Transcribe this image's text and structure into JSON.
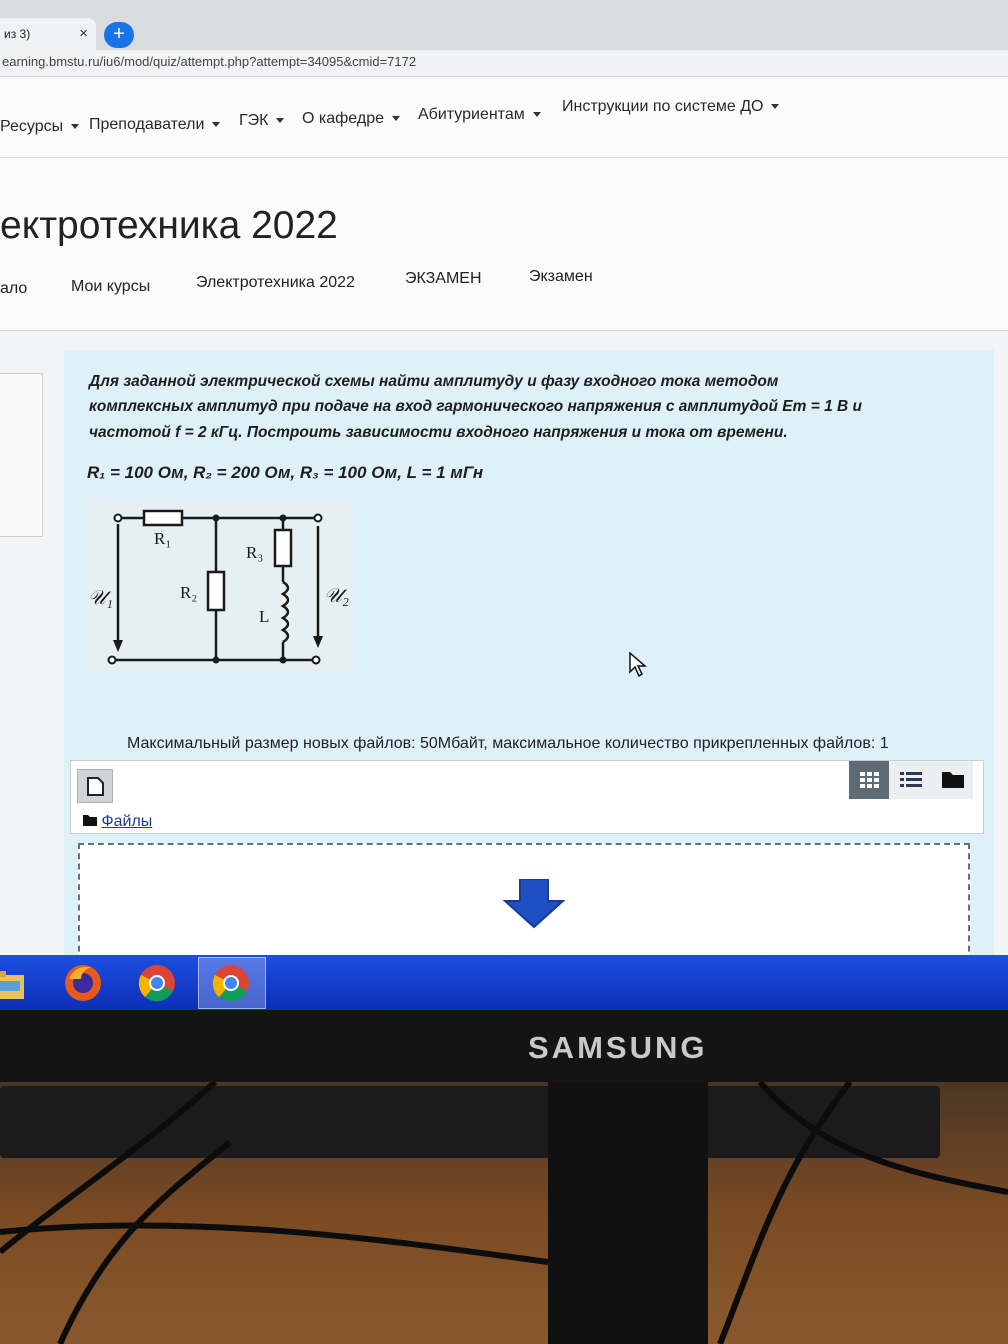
{
  "browser": {
    "tab_label": "из 3)",
    "tab_close": "×",
    "new_tab": "+",
    "url": "earning.bmstu.ru/iu6/mod/quiz/attempt.php?attempt=34095&cmid=7172"
  },
  "navbar": {
    "items": [
      {
        "label": "Ресурсы"
      },
      {
        "label": "Преподаватели"
      },
      {
        "label": "ГЭК"
      },
      {
        "label": "О кафедре"
      },
      {
        "label": "Абитуриентам"
      },
      {
        "label": "Инструкции по системе ДО"
      }
    ]
  },
  "header": {
    "course_title": "ектротехника 2022",
    "breadcrumbs": [
      "ало",
      "Мои курсы",
      "Электротехника 2022",
      "ЭКЗАМЕН",
      "Экзамен"
    ]
  },
  "question": {
    "lines": [
      "Для заданной электрической схемы найти амплитуду и фазу входного тока методом",
      "комплексных амплитуд при подаче на вход гармонического напряжения с амплитудой Em = 1 В и",
      "частотой f = 2 кГц. Построить зависимости входного напряжения и тока от времени."
    ],
    "params": "R₁ = 100 Ом, R₂ = 200 Ом, R₃ = 100 Ом, L = 1 мГн",
    "circuit": {
      "r1": "R₁",
      "r2": "R₂",
      "r3": "R₃",
      "l": "L",
      "u1": "𝒰₁",
      "u2": "𝒰₂"
    }
  },
  "upload": {
    "max_size": "Максимальный размер новых файлов: 50Мбайт, максимальное количество прикрепленных файлов: 1",
    "folder_label": "Файлы"
  },
  "monitor": {
    "brand": "SAMSUNG"
  },
  "colors": {
    "question_bg": "#def0f8",
    "taskbar": "#1d4fe0",
    "link": "#1b3f8f"
  }
}
